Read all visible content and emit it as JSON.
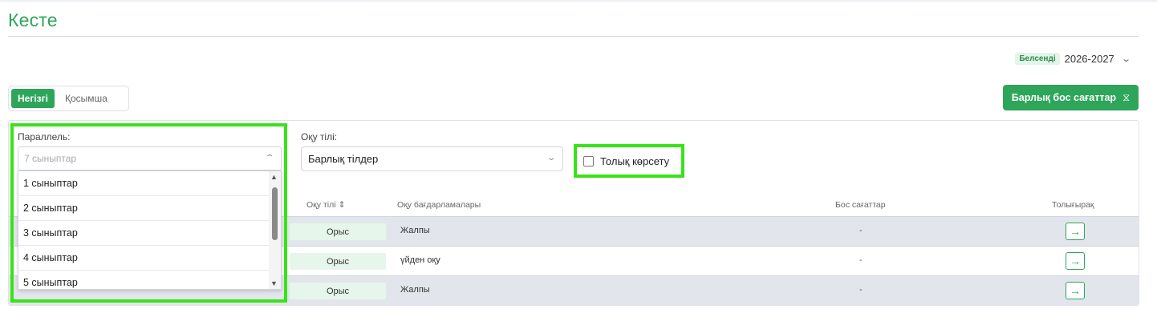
{
  "page": {
    "title": "Кесте"
  },
  "year": {
    "badge": "Белсенді",
    "value": "2026-2027",
    "chevron": "chevron-down-icon"
  },
  "tabs": [
    {
      "label": "Негізгі",
      "active": true
    },
    {
      "label": "Қосымша",
      "active": false
    }
  ],
  "free_hours_button": {
    "label": "Барлық бос сағаттар",
    "icon": "hourglass-icon",
    "glyph": "⌛"
  },
  "filters": {
    "parallel": {
      "label": "Параллель:",
      "placeholder": "7 сыныптар",
      "options": [
        "1 сыныптар",
        "2 сыныптар",
        "3 сыныптар",
        "4 сыныптар",
        "5 сыныптар"
      ]
    },
    "language": {
      "label": "Оқу тілі:",
      "value": "Барлық тілдер"
    },
    "full_show": {
      "label": "Толық көрсету",
      "checked": false
    }
  },
  "table": {
    "headers": {
      "language": "Оқу тілі ⇕",
      "programs": "Оқу бағдарламалары",
      "free_hours": "Бос сағаттар",
      "details": "Толығырақ"
    },
    "rows": [
      {
        "language": "Орыс",
        "program": "Жалпы",
        "free_hours": "-"
      },
      {
        "language": "Орыс",
        "program": "үйден оқу",
        "free_hours": "-"
      },
      {
        "language": "Орыс",
        "program": "Жалпы",
        "free_hours": "-"
      }
    ],
    "details_glyph": "→"
  },
  "colors": {
    "accent": "#2ea65a",
    "highlight": "#37e318",
    "row_shade": "#e2e6ec"
  }
}
